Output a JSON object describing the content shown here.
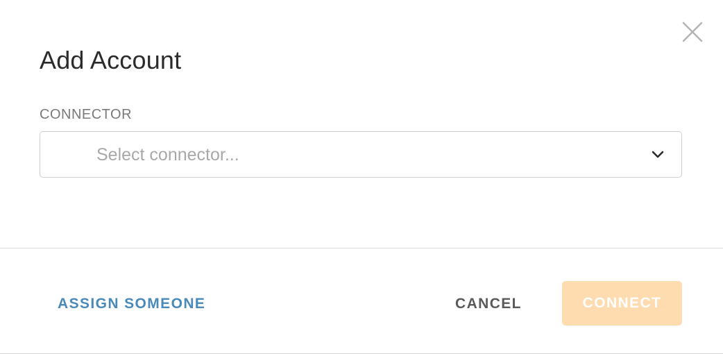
{
  "dialog": {
    "title": "Add Account",
    "close_icon": "close-icon"
  },
  "connector": {
    "label": "CONNECTOR",
    "placeholder": "Select connector...",
    "chevron_icon": "chevron-down-icon"
  },
  "footer": {
    "assign_label": "ASSIGN SOMEONE",
    "cancel_label": "CANCEL",
    "connect_label": "CONNECT"
  },
  "colors": {
    "link": "#4a8ab8",
    "connect_disabled": "#ffdcb0",
    "title_text": "#2b2b2b"
  }
}
